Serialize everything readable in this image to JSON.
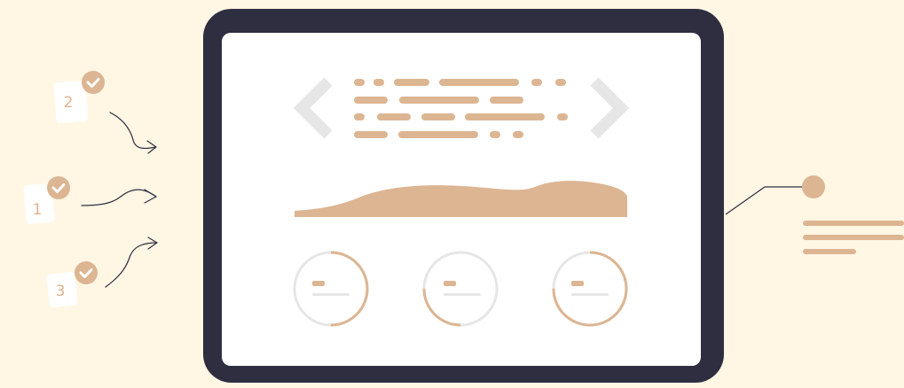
{
  "colors": {
    "background": "#fff6e4",
    "device_frame": "#2f2e41",
    "screen": "#ffffff",
    "accent": "#dcb592",
    "muted": "#e6e6e6",
    "check_badge": "#dcb592",
    "line": "#2f2e41"
  },
  "checklist": [
    {
      "number": "2",
      "checked": true
    },
    {
      "number": "1",
      "checked": true
    },
    {
      "number": "3",
      "checked": true
    }
  ],
  "carousel": {
    "prev_icon": "chevron-left-icon",
    "next_icon": "chevron-right-icon"
  },
  "progress_rings": [
    {
      "progress": 0.5
    },
    {
      "progress": 0.25
    },
    {
      "progress": 0.75
    }
  ]
}
